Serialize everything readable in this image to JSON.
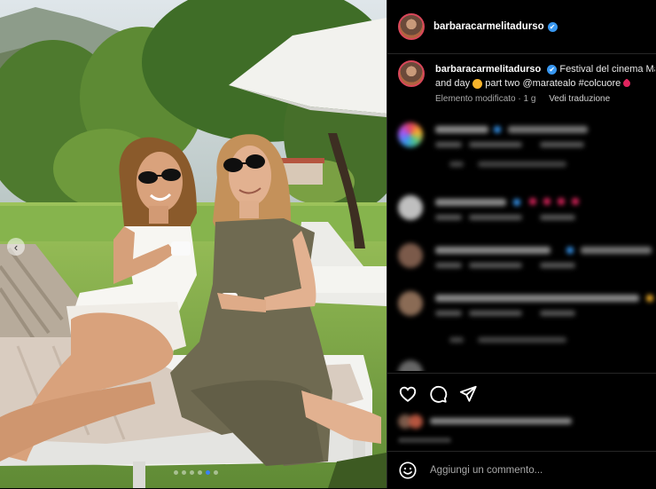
{
  "post": {
    "username": "barbaracarmelitadurso",
    "verified_mark": "✔"
  },
  "caption": {
    "username": "barbaracarmelitadurso",
    "text_line1": "Festival del cinema Ma",
    "text_line2_a": "and day",
    "text_line2_b": "part two @maratealo #colcuore",
    "edited_label": "Elemento modificato",
    "time_ago": "1 g",
    "see_translation": "Vedi traduzione"
  },
  "comment_box": {
    "placeholder": "Aggiungi un commento..."
  },
  "icons": {
    "like": "heart-icon",
    "comment": "comment-icon",
    "share": "send-icon",
    "emoji": "emoji-icon",
    "verified": "verified-badge-icon",
    "carousel_prev": "chevron-left-icon"
  },
  "colors": {
    "background": "#000000",
    "verified": "#3897f0",
    "avatar_ring": "#d9475a",
    "divider": "#262626",
    "carousel_active_dot": "#3b82f6"
  },
  "carousel": {
    "prev_symbol": "‹",
    "total_slides": 6,
    "active_slide": 5
  }
}
